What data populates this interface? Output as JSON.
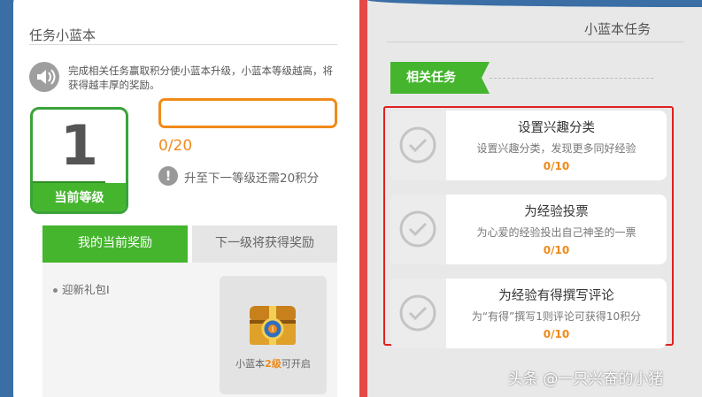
{
  "left": {
    "title": "任务小蓝本",
    "notice": "完成相关任务赢取积分使小蓝本升级，小蓝本等级越高，将获得越丰厚的奖励。",
    "level_value": "1",
    "level_label": "当前等级",
    "progress_value": 0,
    "progress_text": "0/20",
    "warn_icon": "!",
    "warn_text": "升至下一等级还需20积分",
    "tabs": [
      {
        "label": "我的当前奖励"
      },
      {
        "label": "下一级将获得奖励"
      }
    ],
    "reward_item": "迎新礼包I",
    "chest_caption_prefix": "小蓝本",
    "chest_caption_level": "2级",
    "chest_caption_suffix": "可开启"
  },
  "right": {
    "title": "小蓝本任务",
    "section_label": "相关任务",
    "tasks": [
      {
        "title": "设置兴趣分类",
        "desc": "设置兴趣分类，发现更多同好经验",
        "count": "0/10"
      },
      {
        "title": "为经验投票",
        "desc": "为心爱的经验投出自己神圣的一票",
        "count": "0/10"
      },
      {
        "title": "为经验有得撰写评论",
        "desc": "为“有得”撰写1则评论可获得10积分",
        "count": "0/10"
      }
    ]
  },
  "watermark": "头条 @一只兴奋的小猪",
  "colors": {
    "green": "#45b52e",
    "orange": "#f08a1a",
    "red_frame": "#e02020",
    "divider": "#e64848",
    "background": "#3a6ea5"
  },
  "icons": {
    "speaker": "speaker-icon",
    "warn": "exclamation-icon",
    "check": "check-circle-icon",
    "chest": "treasure-chest-icon"
  }
}
